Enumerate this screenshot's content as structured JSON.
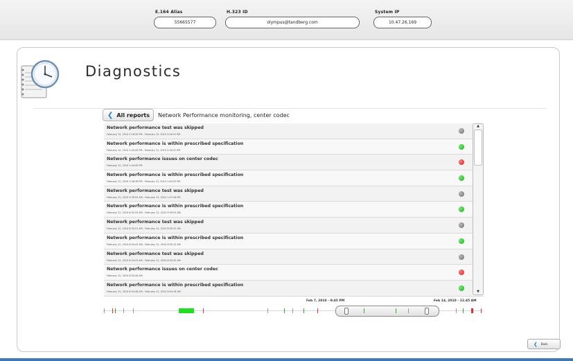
{
  "header": {
    "e164_label": "E.164 Alias",
    "e164_value": "55665577",
    "h323_label": "H.323 ID",
    "h323_value": "olympus@tandberg.com",
    "sysip_label": "System IP",
    "sysip_value": "10.47.26.169"
  },
  "page": {
    "title": "Diagnostics",
    "all_reports": "All reports",
    "breadcrumb": "Network Performance monitoring, center codec"
  },
  "reports": [
    {
      "title": "Network performance test was skipped",
      "date": "February 12, 2010 2:16:39 PM - February 15, 2010 3:26:51 PM",
      "status": "grey"
    },
    {
      "title": "Network performance is within prescribed specification",
      "date": "February 12, 2010 1:44:45 PM - February 12, 2010 2:16:31 PM",
      "status": "green"
    },
    {
      "title": "Network performance issues on center codec",
      "date": "February 12, 2010 1:44:35 PM",
      "status": "red"
    },
    {
      "title": "Network performance is within prescribed specification",
      "date": "February 12, 2010 1:08:38 PM - February 12, 2010 1:44:25 PM",
      "status": "green"
    },
    {
      "title": "Network performance test was skipped",
      "date": "February 12, 2010 9:39:55 AM - February 12, 2010 1:07:56 PM",
      "status": "grey"
    },
    {
      "title": "Network performance is within prescribed specification",
      "date": "February 12, 2010 8:55:33 AM - February 12, 2010 9:39:53 AM",
      "status": "green"
    },
    {
      "title": "Network performance test was skipped",
      "date": "February 12, 2010 8:55:21 AM - February 12, 2010 8:55:22 AM",
      "status": "grey"
    },
    {
      "title": "Network performance is within prescribed specification",
      "date": "February 12, 2010 8:54:42 AM - February 12, 2010 8:55:12 AM",
      "status": "green"
    },
    {
      "title": "Network performance test was skipped",
      "date": "February 12, 2010 8:54:29 AM - February 12, 2010 8:54:32 AM",
      "status": "grey"
    },
    {
      "title": "Network performance issues on center codec",
      "date": "February 12, 2010 8:54:28 AM",
      "status": "red"
    },
    {
      "title": "Network performance is within prescribed specification",
      "date": "February 12, 2010 8:53:48 AM - February 12, 2010 8:54:18 AM",
      "status": "green"
    }
  ],
  "timeline": {
    "start_label": "Feb 7, 2010 - 9:45 PM",
    "end_label": "Feb 14, 2010 - 11:45 AM"
  },
  "footer": {
    "back_label": "Back"
  },
  "colors": {
    "accent": "#1f6eb3",
    "status_grey": "#8a8a8a",
    "status_green": "#22b022",
    "status_red": "#e03030"
  }
}
